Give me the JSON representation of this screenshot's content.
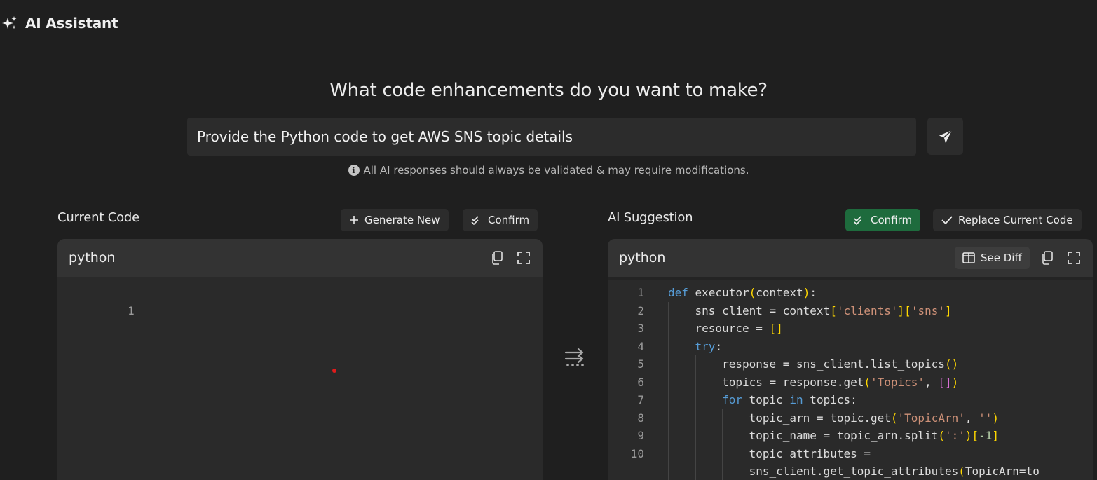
{
  "header": {
    "title": "AI Assistant",
    "icon": "sparkle-icon"
  },
  "prompt": {
    "heading": "What code enhancements do you want to make?",
    "input_value": "Provide the Python code to get AWS SNS topic details",
    "send_icon": "send-icon",
    "disclaimer": "All AI responses should always be validated & may require modifications."
  },
  "current_code": {
    "title": "Current Code",
    "generate_new_label": "Generate New",
    "confirm_label": "Confirm",
    "language": "python",
    "line_numbers": [
      "1"
    ]
  },
  "ai_suggestion": {
    "title": "AI Suggestion",
    "confirm_label": "Confirm",
    "replace_label": "Replace Current Code",
    "language": "python",
    "see_diff_label": "See Diff",
    "line_numbers": [
      "1",
      "2",
      "3",
      "4",
      "5",
      "6",
      "7",
      "8",
      "9",
      "10"
    ],
    "code_lines": [
      "def executor(context):",
      "    sns_client = context['clients']['sns']",
      "    resource = []",
      "    try:",
      "        response = sns_client.list_topics()",
      "        topics = response.get('Topics', [])",
      "        for topic in topics:",
      "            topic_arn = topic.get('TopicArn', '')",
      "            topic_name = topic_arn.split(':')[-1]",
      "            topic_attributes =",
      "            sns_client.get_topic_attributes(TopicArn=to"
    ]
  },
  "colors": {
    "background": "#1f1f1f",
    "surface": "#2c2c2c",
    "confirm_green": "#1e6b3d",
    "keyword": "#569cd6",
    "string": "#ce9178",
    "bracket": "#ffd700"
  }
}
